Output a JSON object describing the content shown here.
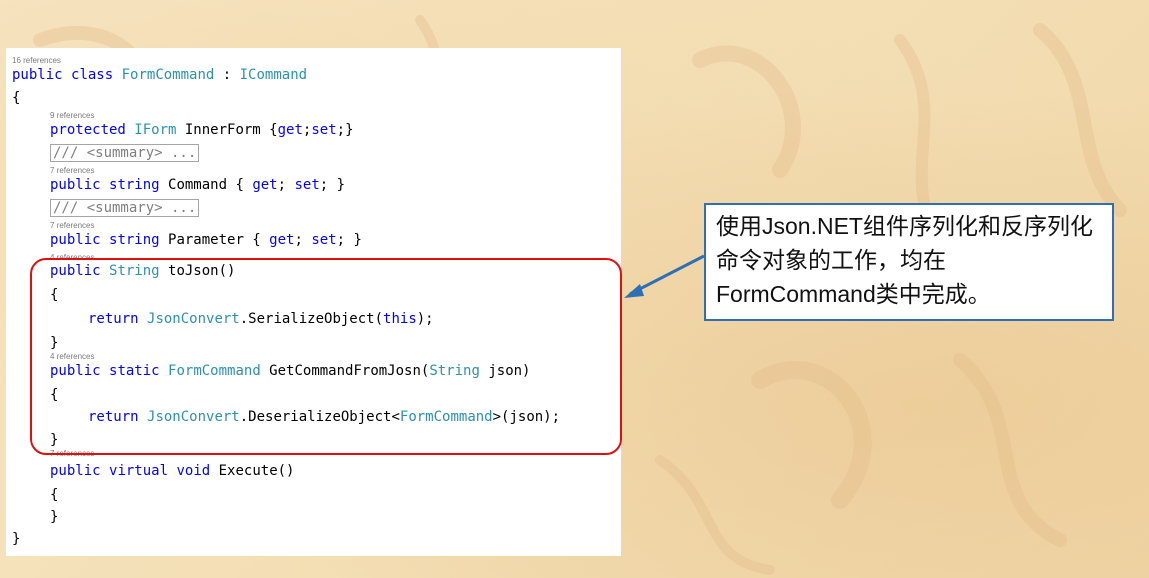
{
  "callout": {
    "text": "使用Json.NET组件序列化和反序列化命令对象的工作，均在FormCommand类中完成。"
  },
  "code": {
    "refs": {
      "class_refs": "16 references",
      "innerform_refs": "9 references",
      "command_refs": "7 references",
      "parameter_refs": "7 references",
      "tojson_refs": "4 references",
      "getcmd_refs": "4 references",
      "execute_refs": "7 references"
    },
    "line1": {
      "kw1": "public",
      "kw2": "class",
      "type1": "FormCommand",
      "sep": " : ",
      "type2": "ICommand"
    },
    "brace_open": "{",
    "line2": {
      "kw": "protected",
      "type": "IForm",
      "rest": " InnerForm {",
      "get": "get",
      "semi1": ";",
      "set": "set",
      "end": ";}"
    },
    "summary1": "/// <summary> ...",
    "line3": {
      "kw1": "public",
      "kw2": "string",
      "rest": " Command { ",
      "get": "get",
      "semi": "; ",
      "set": "set",
      "end": "; }"
    },
    "summary2": "/// <summary> ...",
    "line4": {
      "kw1": "public",
      "kw2": "string",
      "rest": " Parameter { ",
      "get": "get",
      "semi": "; ",
      "set": "set",
      "end": "; }"
    },
    "line5": {
      "kw": "public",
      "type": "String",
      "rest": " toJson()"
    },
    "brace_open2": "{",
    "line6": {
      "kw": "return",
      "type": "JsonConvert",
      "mid": ".SerializeObject(",
      "this": "this",
      "end": ");"
    },
    "brace_close2": "}",
    "line7": {
      "kw1": "public",
      "kw2": "static",
      "type1": "FormCommand",
      "mid": " GetCommandFromJosn(",
      "type2": "String",
      "end": " json)"
    },
    "brace_open3": "{",
    "line8": {
      "kw": "return",
      "type1": "JsonConvert",
      "mid": ".DeserializeObject<",
      "type2": "FormCommand",
      "end": ">(json);"
    },
    "brace_close3": "}",
    "line9": {
      "kw1": "public",
      "kw2": "virtual",
      "kw3": "void",
      "rest": " Execute()"
    },
    "brace_open4": "{",
    "brace_close4": "}",
    "brace_close": "}"
  },
  "colors": {
    "keyword": "#0000ff",
    "type": "#2b91af",
    "highlight_border": "#e01010",
    "callout_border": "#2e6fb6"
  }
}
